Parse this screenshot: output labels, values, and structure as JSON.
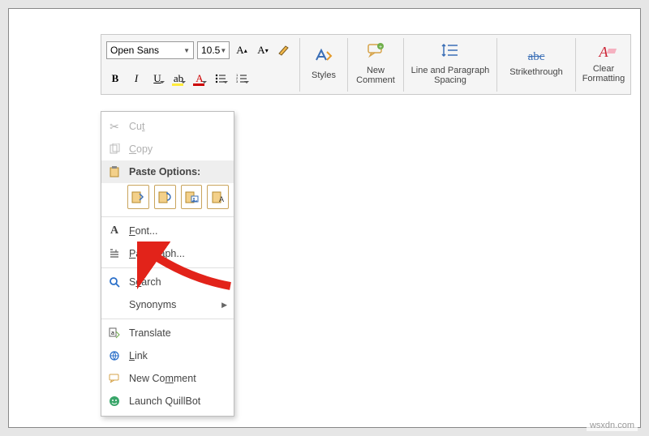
{
  "ribbon": {
    "font_name": "Open Sans",
    "font_size": "10.5",
    "styles_label": "Styles",
    "new_comment_label": "New\nComment",
    "spacing_label": "Line and Paragraph\nSpacing",
    "strike_label": "Strikethrough",
    "clear_label": "Clear\nFormatting"
  },
  "ctx": {
    "cut": "Cut",
    "copy": "Copy",
    "paste_header": "Paste Options:",
    "font": "Font...",
    "paragraph": "Paragraph...",
    "search": "Search",
    "synonyms": "Synonyms",
    "translate": "Translate",
    "link": "Link",
    "new_comment": "New Comment",
    "launch_quillbot": "Launch QuillBot"
  },
  "footer": "wsxdn.com"
}
